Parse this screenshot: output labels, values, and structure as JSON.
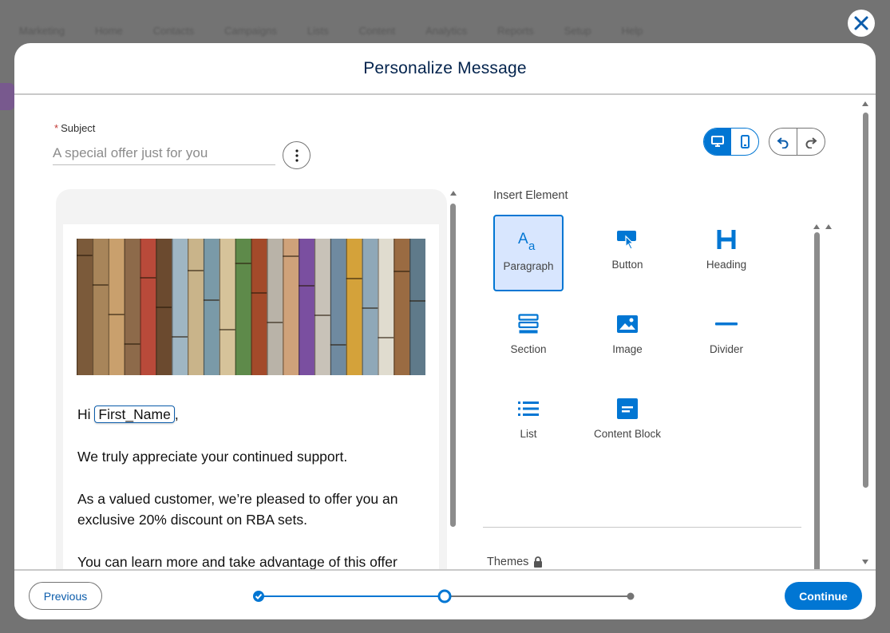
{
  "background": {
    "nav_items": [
      "Marketing",
      "Home",
      "Contacts",
      "Campaigns",
      "Lists",
      "Content",
      "Analytics",
      "Reports",
      "Setup",
      "Help"
    ]
  },
  "modal": {
    "title": "Personalize Message",
    "close_icon": "close-icon"
  },
  "subject": {
    "label": "Subject",
    "required_marker": "*",
    "placeholder": "A special offer just for you",
    "value": ""
  },
  "view_toggle": {
    "options": [
      "desktop-icon",
      "mobile-icon"
    ],
    "selected": "desktop"
  },
  "history": {
    "undo_icon": "undo-icon",
    "redo_icon": "redo-icon"
  },
  "preview": {
    "greeting_prefix": "Hi",
    "merge_tag": "First_Name",
    "greeting_suffix": ",",
    "paragraphs": [
      "We truly appreciate your continued support.",
      "As a valued customer, we’re pleased to offer you an exclusive 20% discount on RBA sets.",
      "You can learn more and take advantage of this offer"
    ],
    "hero_colors": [
      "#7b5a3a",
      "#a8855a",
      "#c9a06d",
      "#8d6a4a",
      "#b94a3a",
      "#6b4a2f",
      "#9fb6c3",
      "#c9b48a",
      "#7a9aa8",
      "#d6c39a",
      "#5e8a4a",
      "#a34a2a",
      "#b9b3a8",
      "#cfa27a",
      "#7a4fa0",
      "#c8c2b8",
      "#6f8aa0",
      "#d4a23a",
      "#8fa8b8",
      "#e0dccf",
      "#9a6b42",
      "#5f7a8a"
    ]
  },
  "insert_panel": {
    "title": "Insert Element",
    "elements": [
      {
        "label": "Paragraph",
        "icon": "paragraph-icon",
        "selected": true
      },
      {
        "label": "Button",
        "icon": "button-icon",
        "selected": false
      },
      {
        "label": "Heading",
        "icon": "heading-icon",
        "selected": false
      },
      {
        "label": "Section",
        "icon": "section-icon",
        "selected": false
      },
      {
        "label": "Image",
        "icon": "image-icon",
        "selected": false
      },
      {
        "label": "Divider",
        "icon": "divider-icon",
        "selected": false
      },
      {
        "label": "List",
        "icon": "list-icon",
        "selected": false
      },
      {
        "label": "Content Block",
        "icon": "content-block-icon",
        "selected": false
      }
    ],
    "themes_label": "Themes",
    "themes_locked": true,
    "themes": [
      {
        "colors": [
          "#0176d3",
          "#ffffff",
          "#000000",
          "#ffffff",
          "#888888"
        ]
      },
      {
        "colors": [
          "#6fbfa8",
          "#0a3d1f",
          "#3a3230",
          "#ffffff",
          "#0d6b52"
        ]
      },
      {
        "colors": [
          "#a3232e",
          "#f7c6c6",
          "#ffffff",
          "#333333",
          "#f5c542"
        ]
      }
    ]
  },
  "footer": {
    "previous_label": "Previous",
    "continue_label": "Continue",
    "progress": {
      "steps": 3,
      "current": 2
    }
  },
  "colors": {
    "brand": "#0176d3",
    "title": "#03234d",
    "required": "#c23934"
  }
}
